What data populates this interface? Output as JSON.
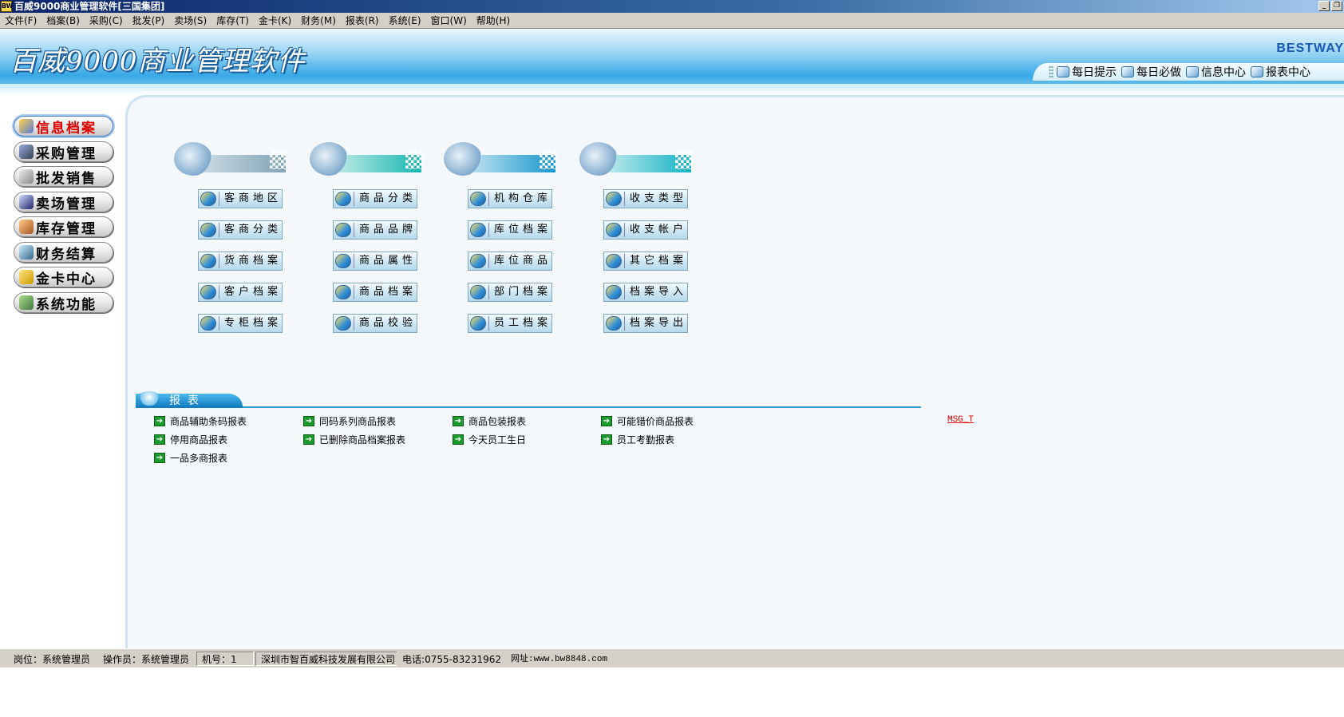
{
  "window": {
    "title": "百威9000商业管理软件[三国集团]",
    "icon_label": "BW"
  },
  "menu": [
    "文件(F)",
    "档案(B)",
    "采购(C)",
    "批发(P)",
    "卖场(S)",
    "库存(T)",
    "金卡(K)",
    "财务(M)",
    "报表(R)",
    "系统(E)",
    "窗口(W)",
    "帮助(H)"
  ],
  "banner": {
    "title": "百威9000商业管理软件",
    "brand": "BESTWAY",
    "quick_links": [
      {
        "label": "每日提示",
        "icon": "clock-icon"
      },
      {
        "label": "每日必做",
        "icon": "task-icon"
      },
      {
        "label": "信息中心",
        "icon": "info-center-icon"
      },
      {
        "label": "报表中心",
        "icon": "report-center-icon"
      }
    ]
  },
  "sidebar": {
    "items": [
      {
        "label": "信息档案",
        "active": true
      },
      {
        "label": "采购管理"
      },
      {
        "label": "批发销售"
      },
      {
        "label": "卖场管理"
      },
      {
        "label": "库存管理"
      },
      {
        "label": "财务结算"
      },
      {
        "label": "金卡中心"
      },
      {
        "label": "系统功能"
      }
    ]
  },
  "archive_columns": [
    {
      "header_icon": "handshake-icon",
      "buttons": [
        "客商地区",
        "客商分类",
        "货商档案",
        "客户档案",
        "专柜档案"
      ]
    },
    {
      "header_icon": "globe-icon",
      "buttons": [
        "商品分类",
        "商品品牌",
        "商品属性",
        "商品档案",
        "商品校验"
      ]
    },
    {
      "header_icon": "computer-icon",
      "buttons": [
        "机构仓库",
        "库位档案",
        "库位商品",
        "部门档案",
        "员工档案"
      ]
    },
    {
      "header_icon": "businessman-icon",
      "buttons": [
        "收支类型",
        "收支帐户",
        "其它档案",
        "档案导入",
        "档案导出"
      ]
    }
  ],
  "reports": {
    "title": "报表",
    "rows": [
      [
        "商品辅助条码报表",
        "同码系列商品报表",
        "商品包装报表",
        "可能错价商品报表"
      ],
      [
        "停用商品报表",
        "已删除商品档案报表",
        "今天员工生日",
        "员工考勤报表"
      ],
      [
        "一品多商报表"
      ]
    ],
    "msg_label": "MSG_T"
  },
  "statusbar": {
    "post": "岗位：系统管理员",
    "operator": "操作员：系统管理员",
    "machine": "机号：1",
    "company": "深圳市智百威科技发展有限公司",
    "phone": "电话:0755-83231962",
    "website": "网址:www.bw8848.com"
  },
  "colors": {
    "accent": "#2a98d6",
    "active_nav": "#e00000",
    "title_bar": "#0a246a"
  }
}
